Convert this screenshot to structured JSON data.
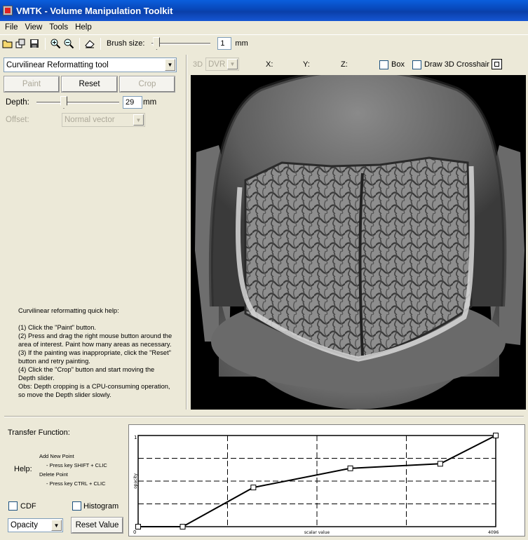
{
  "window": {
    "title": "VMTK - Volume Manipulation Toolkit"
  },
  "menu": [
    "File",
    "View",
    "Tools",
    "Help"
  ],
  "toolbar": {
    "icons": [
      "open-folder-icon",
      "open-series-icon",
      "save-icon",
      "zoom-in-icon",
      "zoom-out-icon",
      "eraser-icon"
    ],
    "brush_label": "Brush size:",
    "brush_value": "1",
    "brush_unit": "mm"
  },
  "tool_panel": {
    "tool_select": "Curvilinear Reformatting tool",
    "paint_label": "Paint",
    "reset_label": "Reset",
    "crop_label": "Crop",
    "depth_label": "Depth:",
    "depth_value": "29",
    "depth_unit": "mm",
    "offset_label": "Offset:",
    "offset_select": "Normal vector"
  },
  "quick_help": {
    "title": "Curvilinear reformatting quick help:",
    "steps": [
      "(1) Click the \"Paint\" button.",
      "(2) Press and drag the right mouse button around the area of interest. Paint how many areas as necessary.",
      "(3) If the painting was inappropriate, click the \"Reset\" button and retry painting.",
      "(4) Click the \"Crop\" button and start moving the Depth slider.",
      "Obs: Depth cropping is a CPU-consuming operation, so move the Depth slider slowly."
    ]
  },
  "viewer": {
    "mode_3d": "3D",
    "render_mode": "DVR",
    "x_label": "X:",
    "y_label": "Y:",
    "z_label": "Z:",
    "box_label": "Box",
    "crosshair_label": "Draw 3D Crosshair"
  },
  "transfer_function": {
    "label": "Transfer Function:",
    "help_label": "Help:",
    "help_lines": [
      "Add New Point",
      "- Press key SHIFT + CLIC",
      "Delete Point",
      "- Press key CTRL + CLIC"
    ],
    "cdf_label": "CDF",
    "histogram_label": "Histogram",
    "channel_select": "Opacity",
    "reset_value_label": "Reset Value"
  },
  "chart_data": {
    "type": "line",
    "xlabel": "scalar value",
    "ylabel": "opacity",
    "xlim": [
      0,
      4096
    ],
    "ylim": [
      0,
      1
    ],
    "x_ticks": [
      "0",
      "4096"
    ],
    "y_ticks": [
      "1"
    ],
    "x": [
      0,
      510,
      1320,
      2430,
      3460,
      4096
    ],
    "y": [
      0,
      0,
      0.43,
      0.64,
      0.69,
      1
    ],
    "grid": true
  }
}
